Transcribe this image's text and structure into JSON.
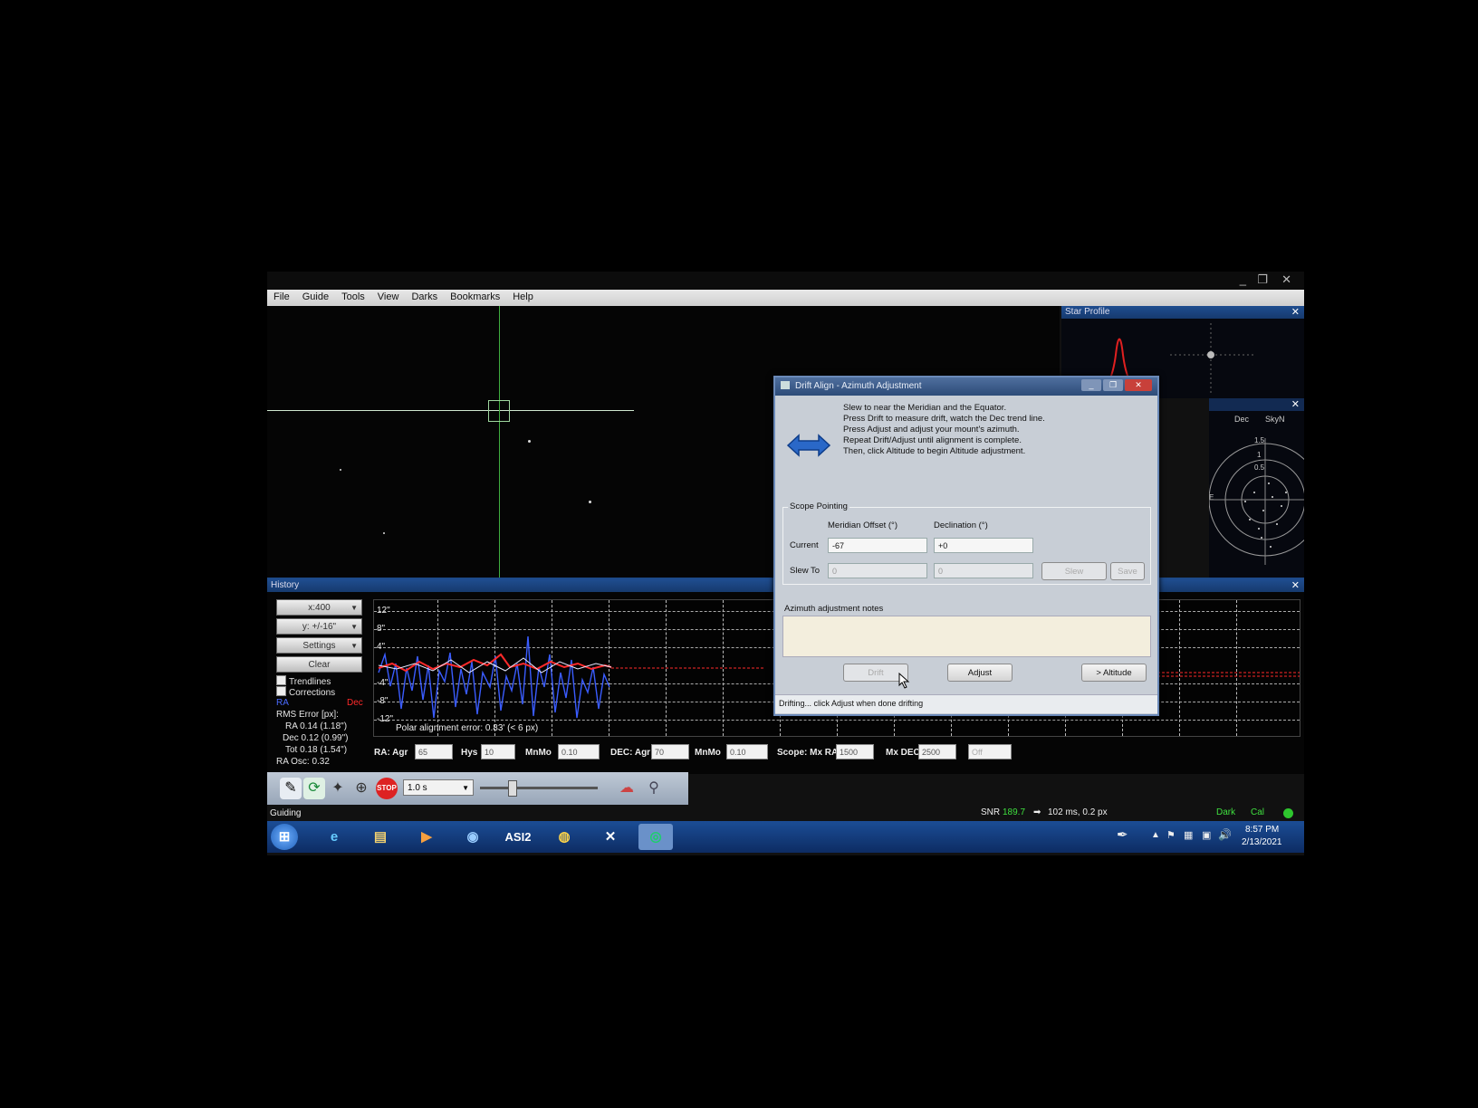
{
  "menu": [
    "File",
    "Guide",
    "Tools",
    "View",
    "Darks",
    "Bookmarks",
    "Help"
  ],
  "window_controls": {
    "minimize": "_",
    "restore": "❐",
    "close": "✕"
  },
  "star_profile": {
    "title": "Star Profile",
    "close": "✕"
  },
  "target": {
    "dec_label": "Dec",
    "sky_label": "SkyN",
    "ring_labels": [
      "1.5",
      "1",
      "0.5"
    ],
    "side_label": "E"
  },
  "history": {
    "title": "History",
    "close": "✕",
    "x_scale": "x:400",
    "y_scale": "y: +/-16\"",
    "settings": "Settings",
    "clear": "Clear",
    "trendlines": "Trendlines",
    "corrections": "Corrections",
    "ra_label": "RA",
    "dec_label": "Dec",
    "rms_header": "RMS Error [px]:",
    "rms_ra": "RA 0.14 (1.18\")",
    "rms_dec": "Dec 0.12 (0.99\")",
    "rms_tot": "Tot 0.18 (1.54\")",
    "ra_osc": "RA Osc: 0.32",
    "y_labels": [
      "12\"",
      "8\"",
      "4\"",
      "-4\"",
      "-8\"",
      "-12\""
    ],
    "polar_error": "Polar alignment error: 0.83' (< 6 px)",
    "params": {
      "ra_agr_label": "RA: Agr",
      "ra_agr": "65",
      "hys_label": "Hys",
      "hys": "10",
      "mnmo1_label": "MnMo",
      "mnmo1": "0.10",
      "dec_agr_label": "DEC: Agr",
      "dec_agr": "70",
      "mnmo2_label": "MnMo",
      "mnmo2": "0.10",
      "scope_label": "Scope: Mx RA",
      "mx_ra": "1500",
      "mx_dec_label": "Mx DEC",
      "mx_dec": "2500",
      "mode": "Off"
    }
  },
  "toolbar": {
    "exposure": "1.0 s",
    "stop": "STOP"
  },
  "status": {
    "mode": "Guiding",
    "snr_label": "SNR",
    "snr": "189.7",
    "timing": "102 ms, 0.2 px",
    "dark": "Dark",
    "cal": "Cal"
  },
  "taskbar": {
    "time": "8:57 PM",
    "date": "2/13/2021",
    "asi_label": "ASI2"
  },
  "dialog": {
    "title": "Drift Align - Azimuth Adjustment",
    "instructions": [
      "Slew to near the Meridian and the Equator.",
      "Press Drift to measure drift, watch the Dec trend line.",
      "Press Adjust and adjust your mount's azimuth.",
      "Repeat Drift/Adjust until alignment is complete.",
      "Then, click Altitude to begin Altitude adjustment."
    ],
    "scope_pointing": "Scope Pointing",
    "meridian_offset_label": "Meridian Offset (°)",
    "declination_label": "Declination (°)",
    "current_label": "Current",
    "current_meridian": "-67",
    "current_dec": "+0",
    "slew_to_label": "Slew To",
    "slew_meridian": "0",
    "slew_dec": "0",
    "slew_btn": "Slew",
    "save_btn": "Save",
    "notes_label": "Azimuth adjustment notes",
    "drift_btn": "Drift",
    "adjust_btn": "Adjust",
    "altitude_btn": "> Altitude",
    "status": "Drifting... click Adjust when done drifting"
  },
  "colors": {
    "ra": "#3a5cff",
    "dec": "#ff2a2a",
    "accent": "#1d4a8a",
    "snr": "#3fe03f"
  }
}
